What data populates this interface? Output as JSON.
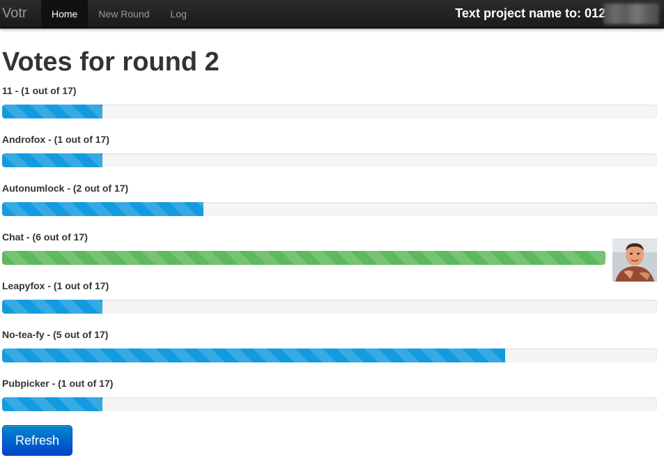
{
  "navbar": {
    "brand": "Votr",
    "items": [
      {
        "label": "Home",
        "active": true
      },
      {
        "label": "New Round",
        "active": false
      },
      {
        "label": "Log",
        "active": false
      }
    ],
    "project_text": "Text project name to: 012"
  },
  "page": {
    "title": "Votes for round 2"
  },
  "candidates": [
    {
      "label": "11 - (1 out of 17)",
      "votes": 1,
      "total": 17,
      "winner": false
    },
    {
      "label": "Androfox - (1 out of 17)",
      "votes": 1,
      "total": 17,
      "winner": false
    },
    {
      "label": "Autonumlock - (2 out of 17)",
      "votes": 2,
      "total": 17,
      "winner": false
    },
    {
      "label": "Chat - (6 out of 17)",
      "votes": 6,
      "total": 17,
      "winner": true
    },
    {
      "label": "Leapyfox - (1 out of 17)",
      "votes": 1,
      "total": 17,
      "winner": false
    },
    {
      "label": "No-tea-fy - (5 out of 17)",
      "votes": 5,
      "total": 17,
      "winner": false
    },
    {
      "label": "Pubpicker - (1 out of 17)",
      "votes": 1,
      "total": 17,
      "winner": false
    }
  ],
  "actions": {
    "refresh_label": "Refresh"
  },
  "colors": {
    "navbar_bg": "#1b1b1b",
    "progress_blue": "#149bdf",
    "progress_green": "#5eb95e",
    "button_primary": "#0055cc"
  }
}
